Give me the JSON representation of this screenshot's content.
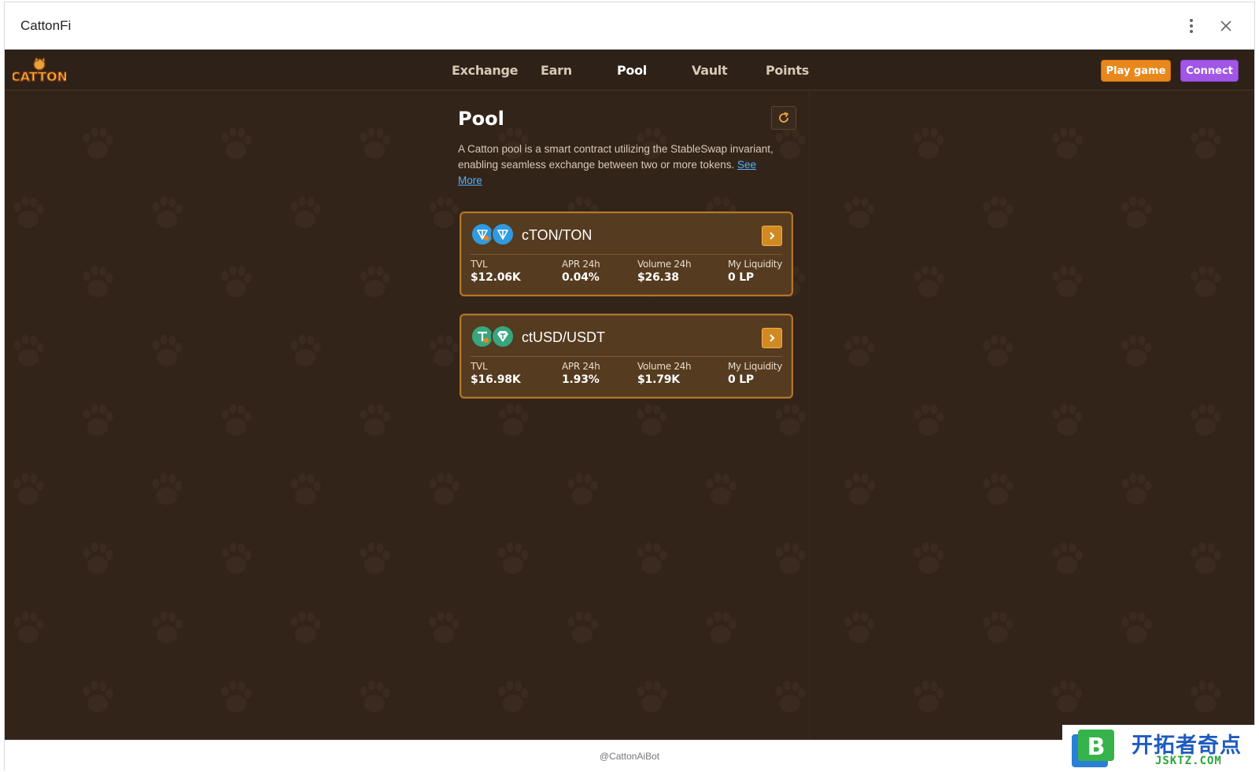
{
  "window": {
    "title": "CattonFi"
  },
  "navbar": {
    "logo_text": "CATTON",
    "items": [
      {
        "label": "Exchange",
        "active": false
      },
      {
        "label": "Earn",
        "active": false
      },
      {
        "label": "Pool",
        "active": true
      },
      {
        "label": "Vault",
        "active": false
      },
      {
        "label": "Points",
        "active": false
      }
    ],
    "play_label": "Play game",
    "connect_label": "Connect"
  },
  "main": {
    "title": "Pool",
    "refresh_icon": "refresh-icon",
    "description": "A Catton pool is a smart contract utilizing the StableSwap invariant, enabling seamless exchange between two or more tokens.",
    "see_more": "See More",
    "pools": [
      {
        "pair": "cTON/TON",
        "icon_a": "cton-coin-icon",
        "icon_b": "ton-coin-icon",
        "stats": [
          {
            "label": "TVL",
            "value": "$12.06K"
          },
          {
            "label": "APR 24h",
            "value": "0.04%"
          },
          {
            "label": "Volume 24h",
            "value": "$26.38"
          },
          {
            "label": "My Liquidity",
            "value": "0 LP"
          }
        ]
      },
      {
        "pair": "ctUSD/USDT",
        "icon_a": "ctusd-coin-icon",
        "icon_b": "usdt-coin-icon",
        "stats": [
          {
            "label": "TVL",
            "value": "$16.98K"
          },
          {
            "label": "APR 24h",
            "value": "1.93%"
          },
          {
            "label": "Volume 24h",
            "value": "$1.79K"
          },
          {
            "label": "My Liquidity",
            "value": "0 LP"
          }
        ]
      }
    ]
  },
  "footer": {
    "bot": "@CattonAiBot"
  },
  "watermark": {
    "cn": "开拓者奇点",
    "en": "JSKTZ.COM",
    "badge_letter": "B"
  },
  "colors": {
    "background": "#33241a",
    "card": "#553b1f",
    "card_border": "#b57625",
    "play_button": "#e8881c",
    "connect_button": "#a156e6",
    "link": "#4fb3ff"
  }
}
